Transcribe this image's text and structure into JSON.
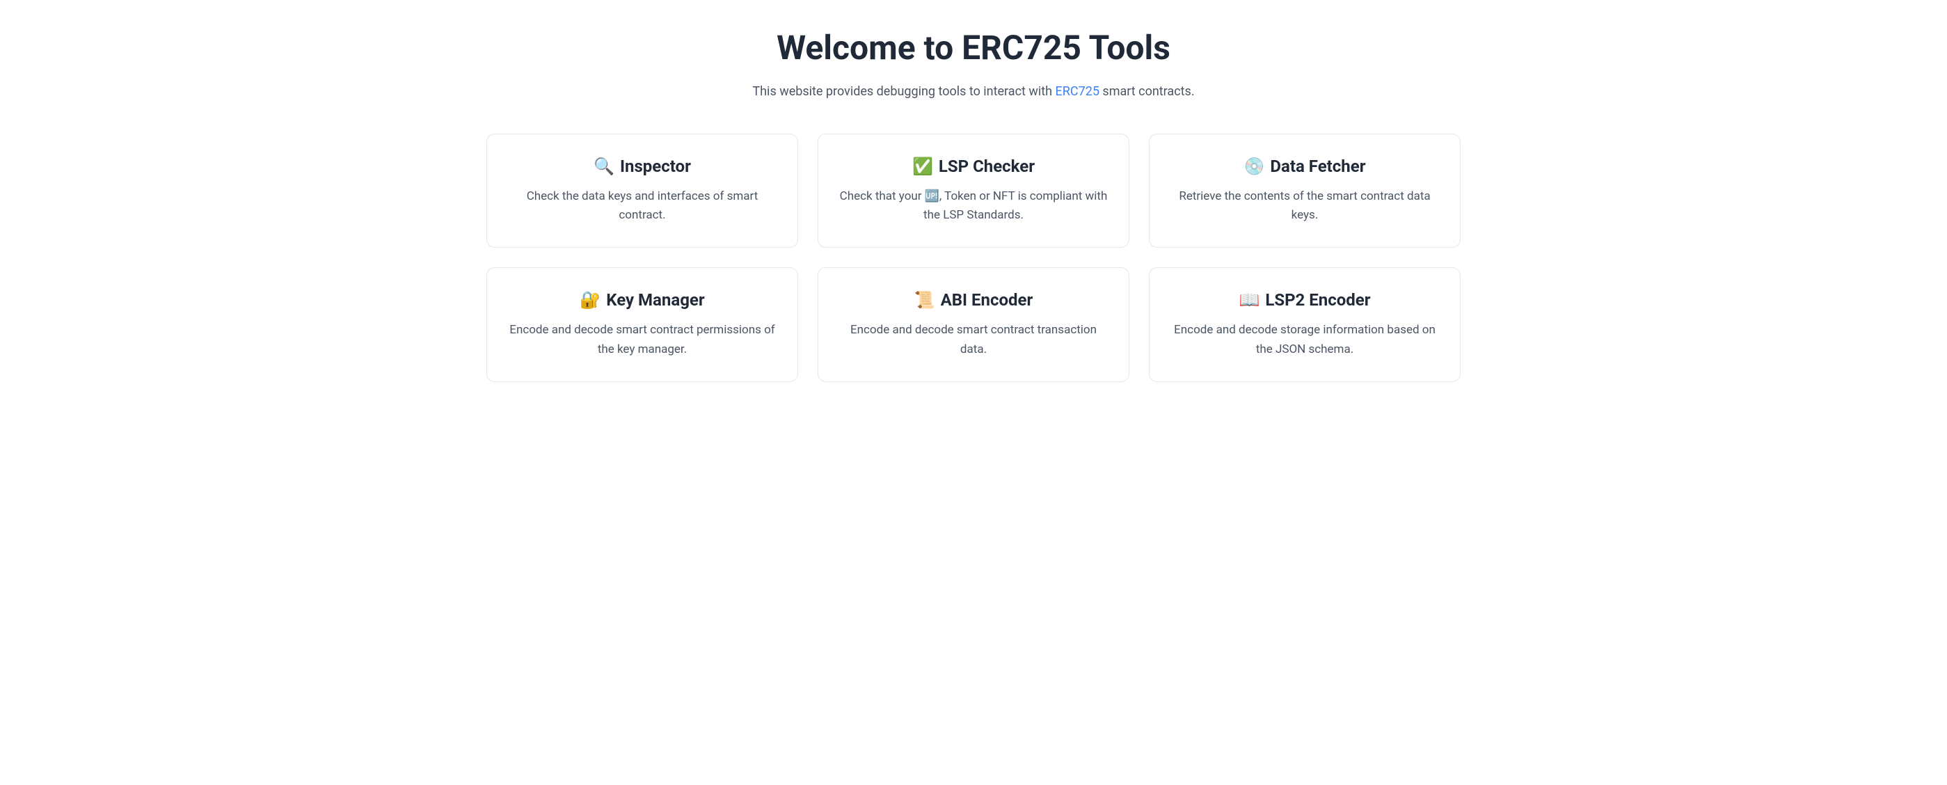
{
  "header": {
    "title": "Welcome to ERC725 Tools",
    "subtitle_prefix": "This website provides debugging tools to interact with ",
    "subtitle_link": "ERC725",
    "subtitle_suffix": " smart contracts."
  },
  "cards": [
    {
      "icon": "🔍",
      "title": "Inspector",
      "description": "Check the data keys and interfaces of smart contract."
    },
    {
      "icon": "✅",
      "title": "LSP Checker",
      "description": "Check that your 🆙, Token or NFT is compliant with the LSP Standards."
    },
    {
      "icon": "💿",
      "title": "Data Fetcher",
      "description": "Retrieve the contents of the smart contract data keys."
    },
    {
      "icon": "🔐",
      "title": "Key Manager",
      "description": "Encode and decode smart contract permissions of the key manager."
    },
    {
      "icon": "📜",
      "title": "ABI Encoder",
      "description": "Encode and decode smart contract transaction data."
    },
    {
      "icon": "📖",
      "title": "LSP2 Encoder",
      "description": "Encode and decode storage information based on the JSON schema."
    }
  ]
}
